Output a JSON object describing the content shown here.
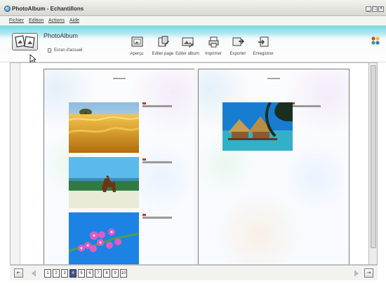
{
  "window": {
    "title": "PhotoAlbum - Echantillons",
    "controls": [
      "_",
      "□",
      "×"
    ]
  },
  "menu": {
    "items": [
      "Fichier",
      "Edition",
      "Actions",
      "Aide"
    ]
  },
  "toolbar": {
    "app_name": "PhotoAlbum",
    "home_label": "Ecran d'accueil",
    "tools": [
      {
        "label": "Aperçu",
        "icon": "preview-icon"
      },
      {
        "label": "Editer page",
        "icon": "edit-page-icon"
      },
      {
        "label": "Editer album",
        "icon": "edit-album-icon"
      },
      {
        "label": "Imprimer",
        "icon": "print-icon"
      },
      {
        "label": "Exporter",
        "icon": "export-icon"
      },
      {
        "label": "Enregistrer",
        "icon": "save-icon"
      }
    ]
  },
  "album": {
    "left_page": {
      "photos": [
        {
          "name": "wheat-field-photo"
        },
        {
          "name": "dog-beach-photo"
        },
        {
          "name": "flowers-sky-photo"
        }
      ]
    },
    "right_page": {
      "photos": [
        {
          "name": "beach-huts-photo"
        }
      ]
    }
  },
  "pager": {
    "pages": [
      "1",
      "2",
      "3",
      "4",
      "5",
      "6",
      "7",
      "8",
      "9",
      "10"
    ],
    "current_page": "4"
  },
  "colors": {
    "toolbar_accent": "#7fd6e8",
    "active_page": "#45528d",
    "caption_accent": "#c43a2d"
  }
}
